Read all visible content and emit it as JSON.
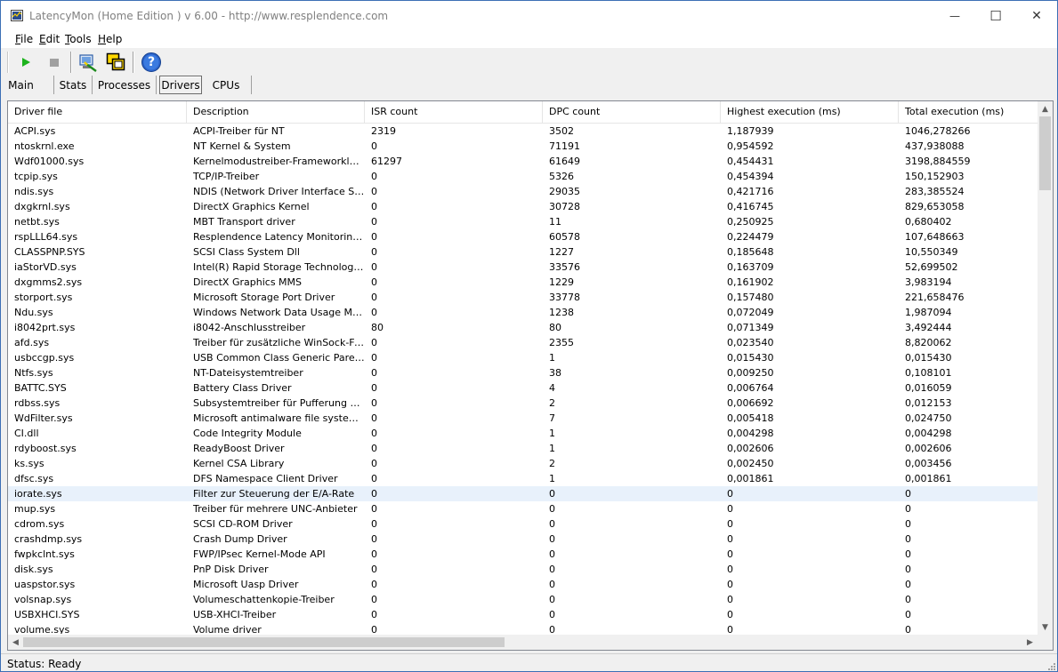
{
  "window": {
    "title": "LatencyMon  (Home Edition )  v 6.00 - http://www.resplendence.com",
    "minimize": "—",
    "maximize": "☐",
    "close": "✕"
  },
  "menu": [
    {
      "key": "F",
      "rest": "ile"
    },
    {
      "key": "E",
      "rest": "dit"
    },
    {
      "key": "T",
      "rest": "ools"
    },
    {
      "key": "H",
      "rest": "elp"
    }
  ],
  "toolbar": {
    "start_icon": "play-icon",
    "stop_icon": "stop-icon",
    "accent_play": "#1db31d",
    "help_glyph": "?"
  },
  "tabs": [
    {
      "label": "Main",
      "ul": "M",
      "active": false
    },
    {
      "label": "Stats",
      "ul": "S",
      "active": false
    },
    {
      "label": "Processes",
      "ul": "P",
      "active": false
    },
    {
      "label": "Drivers",
      "ul": "D",
      "active": true
    },
    {
      "label": "CPUs",
      "ul": "C",
      "active": false
    }
  ],
  "table": {
    "columns": [
      "Driver file",
      "Description",
      "ISR count",
      "DPC count",
      "Highest execution (ms)",
      "Total execution (ms)"
    ],
    "rows": [
      [
        "ACPI.sys",
        "ACPI-Treiber für NT",
        "2319",
        "3502",
        "1,187939",
        "1046,278266"
      ],
      [
        "ntoskrnl.exe",
        "NT Kernel & System",
        "0",
        "71191",
        "0,954592",
        "437,938088"
      ],
      [
        "Wdf01000.sys",
        "Kernelmodustreiber-Frameworklaufzeit",
        "61297",
        "61649",
        "0,454431",
        "3198,884559"
      ],
      [
        "tcpip.sys",
        "TCP/IP-Treiber",
        "0",
        "5326",
        "0,454394",
        "150,152903"
      ],
      [
        "ndis.sys",
        "NDIS (Network Driver Interface Spe...",
        "0",
        "29035",
        "0,421716",
        "283,385524"
      ],
      [
        "dxgkrnl.sys",
        "DirectX Graphics Kernel",
        "0",
        "30728",
        "0,416745",
        "829,653058"
      ],
      [
        "netbt.sys",
        "MBT Transport driver",
        "0",
        "11",
        "0,250925",
        "0,680402"
      ],
      [
        "rspLLL64.sys",
        "Resplendence Latency Monitoring a...",
        "0",
        "60578",
        "0,224479",
        "107,648663"
      ],
      [
        "CLASSPNP.SYS",
        "SCSI Class System Dll",
        "0",
        "1227",
        "0,185648",
        "10,550349"
      ],
      [
        "iaStorVD.sys",
        "Intel(R) Rapid Storage Technology ...",
        "0",
        "33576",
        "0,163709",
        "52,699502"
      ],
      [
        "dxgmms2.sys",
        "DirectX Graphics MMS",
        "0",
        "1229",
        "0,161902",
        "3,983194"
      ],
      [
        "storport.sys",
        "Microsoft Storage Port Driver",
        "0",
        "33778",
        "0,157480",
        "221,658476"
      ],
      [
        "Ndu.sys",
        "Windows Network Data Usage Monit...",
        "0",
        "1238",
        "0,072049",
        "1,987094"
      ],
      [
        "i8042prt.sys",
        "i8042-Anschlusstreiber",
        "80",
        "80",
        "0,071349",
        "3,492444"
      ],
      [
        "afd.sys",
        "Treiber für zusätzliche WinSock-Fun...",
        "0",
        "2355",
        "0,023540",
        "8,820062"
      ],
      [
        "usbccgp.sys",
        "USB Common Class Generic Parent ...",
        "0",
        "1",
        "0,015430",
        "0,015430"
      ],
      [
        "Ntfs.sys",
        "NT-Dateisystemtreiber",
        "0",
        "38",
        "0,009250",
        "0,108101"
      ],
      [
        "BATTC.SYS",
        "Battery Class Driver",
        "0",
        "4",
        "0,006764",
        "0,016059"
      ],
      [
        "rdbss.sys",
        "Subsystemtreiber für Pufferung des...",
        "0",
        "2",
        "0,006692",
        "0,012153"
      ],
      [
        "WdFilter.sys",
        "Microsoft antimalware file system filt...",
        "0",
        "7",
        "0,005418",
        "0,024750"
      ],
      [
        "CI.dll",
        "Code Integrity Module",
        "0",
        "1",
        "0,004298",
        "0,004298"
      ],
      [
        "rdyboost.sys",
        "ReadyBoost Driver",
        "0",
        "1",
        "0,002606",
        "0,002606"
      ],
      [
        "ks.sys",
        "Kernel CSA Library",
        "0",
        "2",
        "0,002450",
        "0,003456"
      ],
      [
        "dfsc.sys",
        "DFS Namespace Client Driver",
        "0",
        "1",
        "0,001861",
        "0,001861"
      ],
      [
        "iorate.sys",
        "Filter zur Steuerung der E/A-Rate",
        "0",
        "0",
        "0",
        "0"
      ],
      [
        "mup.sys",
        "Treiber für mehrere UNC-Anbieter",
        "0",
        "0",
        "0",
        "0"
      ],
      [
        "cdrom.sys",
        "SCSI CD-ROM Driver",
        "0",
        "0",
        "0",
        "0"
      ],
      [
        "crashdmp.sys",
        "Crash Dump Driver",
        "0",
        "0",
        "0",
        "0"
      ],
      [
        "fwpkclnt.sys",
        "FWP/IPsec Kernel-Mode API",
        "0",
        "0",
        "0",
        "0"
      ],
      [
        "disk.sys",
        "PnP Disk Driver",
        "0",
        "0",
        "0",
        "0"
      ],
      [
        "uaspstor.sys",
        "Microsoft Uasp Driver",
        "0",
        "0",
        "0",
        "0"
      ],
      [
        "volsnap.sys",
        "Volumeschattenkopie-Treiber",
        "0",
        "0",
        "0",
        "0"
      ],
      [
        "USBXHCI.SYS",
        "USB-XHCI-Treiber",
        "0",
        "0",
        "0",
        "0"
      ],
      [
        "volume.sys",
        "Volume driver",
        "0",
        "0",
        "0",
        "0"
      ]
    ],
    "selected_row": 24
  },
  "status": {
    "text": "Status: Ready"
  }
}
